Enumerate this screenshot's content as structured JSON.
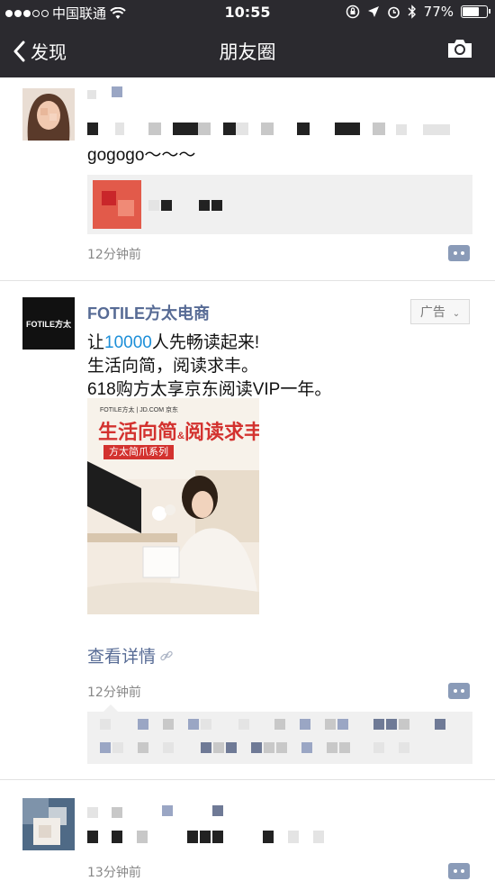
{
  "status_bar": {
    "carrier": "中国联通",
    "time": "10:55",
    "battery": "77%",
    "battery_level": 0.77
  },
  "nav": {
    "back_label": "发现",
    "title": "朋友圈"
  },
  "posts": [
    {
      "text": "gogogo～～～",
      "time": "12分钟前"
    },
    {
      "nickname": "FOTILE方太电商",
      "ad_label": "广告",
      "line1_prefix": "让",
      "line1_link": "10000",
      "line1_suffix": "人先畅读起来!",
      "line2": "生活向简，阅读求丰。",
      "line3": "618购方太享京东阅读VIP一年。",
      "logo_text": "FOTILE方太",
      "image": {
        "brand": "FOTILE方太 | JD.COM 京东",
        "headline_a": "生活向简",
        "amp": "&",
        "headline_b": "阅读求丰",
        "banner": "方太简爪系列"
      },
      "details_label": "查看详情",
      "time": "12分钟前"
    },
    {
      "time": "13分钟前"
    }
  ]
}
